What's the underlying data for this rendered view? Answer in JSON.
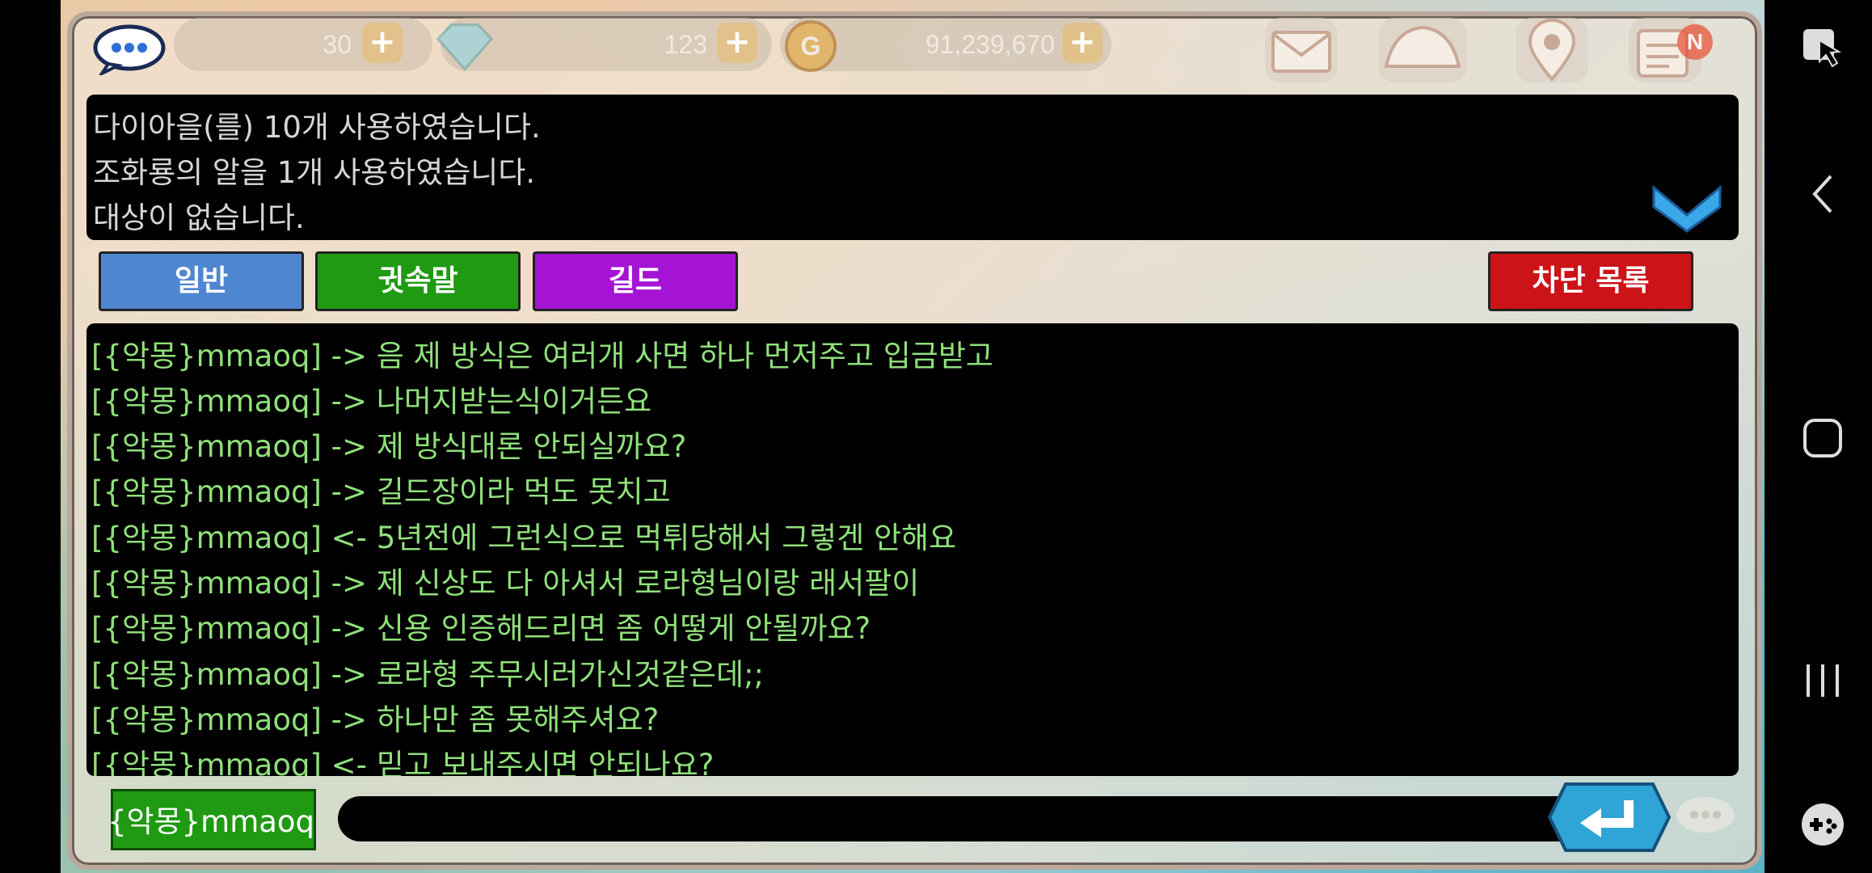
{
  "hud": {
    "energy_value": "30",
    "diamond_value": "123",
    "gold_value": "91,239,670",
    "new_badge": "N",
    "plus_label": "+"
  },
  "system_log": {
    "lines": [
      "다이아을(를) 10개 사용하였습니다.",
      "조화룡의 알을 1개 사용하였습니다.",
      "대상이 없습니다."
    ]
  },
  "tabs": {
    "general": "일반",
    "whisper": "귓속말",
    "guild": "길드",
    "block_list": "차단 목록"
  },
  "chat": {
    "lines": [
      "[{악몽}mmaoq] -> 음 제 방식은 여러개 사면 하나 먼저주고 입금받고",
      "[{악몽}mmaoq] -> 나머지받는식이거든요",
      "[{악몽}mmaoq] -> 제 방식대론 안되실까요?",
      "[{악몽}mmaoq] -> 길드장이라 먹도 못치고",
      "[{악몽}mmaoq] <- 5년전에 그런식으로 먹튀당해서 그렇겐 안해요",
      "[{악몽}mmaoq] -> 제 신상도 다 아셔서 로라형님이랑 래서팔이",
      "[{악몽}mmaoq] -> 신용 인증해드리면 좀 어떻게 안될까요?",
      "[{악몽}mmaoq] -> 로라형 주무시러가신것같은데;;",
      "[{악몽}mmaoq] -> 하나만 좀 못해주셔요?",
      "[{악몽}mmaoq] <- 믿고 보내주시면 안되나요?"
    ]
  },
  "input": {
    "target": "{악몽}mmaoq",
    "value": ""
  },
  "colors": {
    "general_tab": "#4f86d0",
    "whisper_tab": "#1f9a12",
    "guild_tab": "#a514d4",
    "block_tab": "#cc1418",
    "chat_text": "#8fe07a",
    "log_text": "#d6d6d6"
  },
  "icons": [
    "chat-bubble-icon",
    "energy-icon",
    "diamond-icon",
    "gold-coin-icon",
    "mail-icon",
    "shop-icon",
    "map-pin-icon",
    "menu-list-icon",
    "collapse-chevron-icon",
    "send-enter-icon",
    "emoji-bubble-icon",
    "screenshot-touch-icon",
    "back-icon",
    "home-icon",
    "recents-icon",
    "game-controller-icon"
  ]
}
